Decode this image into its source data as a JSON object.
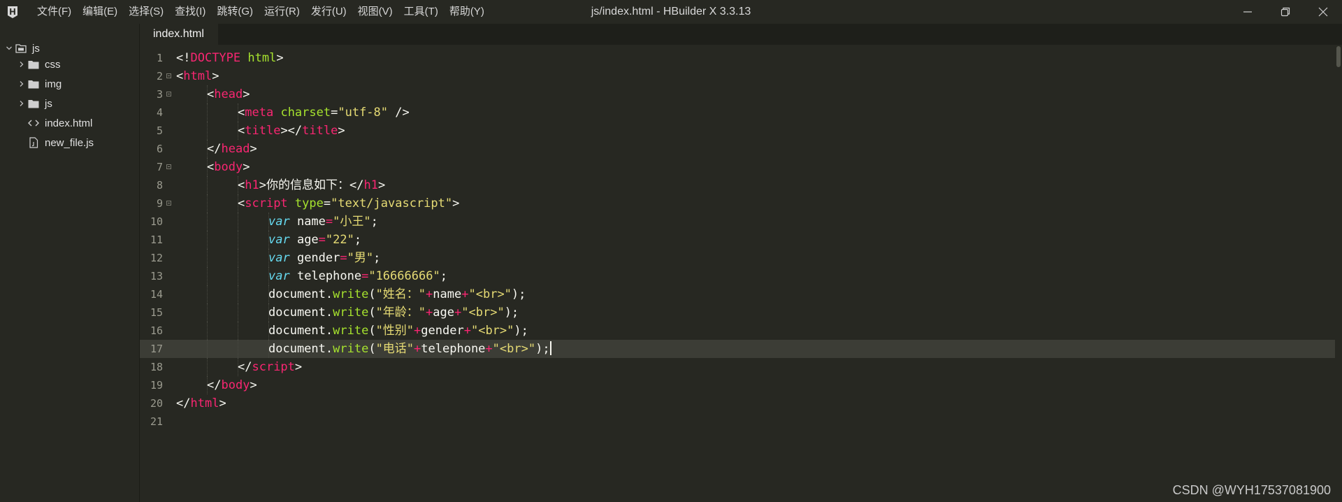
{
  "window": {
    "title": "js/index.html - HBuilder X 3.3.13",
    "app_icon": "hbuilder-logo",
    "controls": [
      "minimize-icon",
      "restore-icon",
      "close-icon"
    ]
  },
  "menu": [
    "文件(F)",
    "编辑(E)",
    "选择(S)",
    "查找(I)",
    "跳转(G)",
    "运行(R)",
    "发行(U)",
    "视图(V)",
    "工具(T)",
    "帮助(Y)"
  ],
  "sidebar": {
    "items": [
      {
        "label": "js",
        "icon": "project-icon",
        "chevron": "expanded",
        "level": 0
      },
      {
        "label": "css",
        "icon": "folder-icon",
        "chevron": "collapsed",
        "level": 1
      },
      {
        "label": "img",
        "icon": "folder-icon",
        "chevron": "collapsed",
        "level": 1
      },
      {
        "label": "js",
        "icon": "folder-icon",
        "chevron": "collapsed",
        "level": 1
      },
      {
        "label": "index.html",
        "icon": "html-file-icon",
        "chevron": "",
        "level": 1
      },
      {
        "label": "new_file.js",
        "icon": "js-file-icon",
        "chevron": "",
        "level": 1
      }
    ]
  },
  "tabs": [
    {
      "label": "index.html",
      "active": true
    }
  ],
  "editor": {
    "active_line": 17,
    "lines": [
      {
        "n": "1",
        "fold": false,
        "indent": 0,
        "tokens": [
          [
            "p",
            "<!"
          ],
          [
            "tag",
            "DOCTYPE"
          ],
          [
            "p",
            " "
          ],
          [
            "attr",
            "html"
          ],
          [
            "p",
            ">"
          ]
        ]
      },
      {
        "n": "2",
        "fold": true,
        "indent": 0,
        "tokens": [
          [
            "p",
            "<"
          ],
          [
            "tag",
            "html"
          ],
          [
            "p",
            ">"
          ]
        ]
      },
      {
        "n": "3",
        "fold": true,
        "indent": 1,
        "tokens": [
          [
            "p",
            "<"
          ],
          [
            "tag",
            "head"
          ],
          [
            "p",
            ">"
          ]
        ]
      },
      {
        "n": "4",
        "fold": false,
        "indent": 2,
        "tokens": [
          [
            "p",
            "<"
          ],
          [
            "tag",
            "meta"
          ],
          [
            "p",
            " "
          ],
          [
            "attr",
            "charset"
          ],
          [
            "p",
            "="
          ],
          [
            "str",
            "\"utf-8\""
          ],
          [
            "p",
            " />"
          ]
        ]
      },
      {
        "n": "5",
        "fold": false,
        "indent": 2,
        "tokens": [
          [
            "p",
            "<"
          ],
          [
            "tag",
            "title"
          ],
          [
            "p",
            "></"
          ],
          [
            "tag",
            "title"
          ],
          [
            "p",
            ">"
          ]
        ]
      },
      {
        "n": "6",
        "fold": false,
        "indent": 1,
        "tokens": [
          [
            "p",
            "</"
          ],
          [
            "tag",
            "head"
          ],
          [
            "p",
            ">"
          ]
        ]
      },
      {
        "n": "7",
        "fold": true,
        "indent": 1,
        "tokens": [
          [
            "p",
            "<"
          ],
          [
            "tag",
            "body"
          ],
          [
            "p",
            ">"
          ]
        ]
      },
      {
        "n": "8",
        "fold": false,
        "indent": 2,
        "tokens": [
          [
            "p",
            "<"
          ],
          [
            "tag",
            "h1"
          ],
          [
            "p",
            ">你的信息如下：</"
          ],
          [
            "tag",
            "h1"
          ],
          [
            "p",
            ">"
          ]
        ]
      },
      {
        "n": "9",
        "fold": true,
        "indent": 2,
        "tokens": [
          [
            "p",
            "<"
          ],
          [
            "tag",
            "script"
          ],
          [
            "p",
            " "
          ],
          [
            "attr",
            "type"
          ],
          [
            "p",
            "="
          ],
          [
            "str",
            "\"text/javascript\""
          ],
          [
            "p",
            ">"
          ]
        ]
      },
      {
        "n": "10",
        "fold": false,
        "indent": 3,
        "tokens": [
          [
            "kw",
            "var"
          ],
          [
            "p",
            " name"
          ],
          [
            "op",
            "="
          ],
          [
            "str",
            "\"小王\""
          ],
          [
            "p",
            ";"
          ]
        ]
      },
      {
        "n": "11",
        "fold": false,
        "indent": 3,
        "tokens": [
          [
            "kw",
            "var"
          ],
          [
            "p",
            " age"
          ],
          [
            "op",
            "="
          ],
          [
            "str",
            "\"22\""
          ],
          [
            "p",
            ";"
          ]
        ]
      },
      {
        "n": "12",
        "fold": false,
        "indent": 3,
        "tokens": [
          [
            "kw",
            "var"
          ],
          [
            "p",
            " gender"
          ],
          [
            "op",
            "="
          ],
          [
            "str",
            "\"男\""
          ],
          [
            "p",
            ";"
          ]
        ]
      },
      {
        "n": "13",
        "fold": false,
        "indent": 3,
        "tokens": [
          [
            "kw",
            "var"
          ],
          [
            "p",
            " telephone"
          ],
          [
            "op",
            "="
          ],
          [
            "str",
            "\"16666666\""
          ],
          [
            "p",
            ";"
          ]
        ]
      },
      {
        "n": "14",
        "fold": false,
        "indent": 3,
        "tokens": [
          [
            "p",
            "document."
          ],
          [
            "fn",
            "write"
          ],
          [
            "p",
            "("
          ],
          [
            "str",
            "\"姓名：\""
          ],
          [
            "op",
            "+"
          ],
          [
            "p",
            "name"
          ],
          [
            "op",
            "+"
          ],
          [
            "str",
            "\"<br>\""
          ],
          [
            "p",
            ");"
          ]
        ]
      },
      {
        "n": "15",
        "fold": false,
        "indent": 3,
        "tokens": [
          [
            "p",
            "document."
          ],
          [
            "fn",
            "write"
          ],
          [
            "p",
            "("
          ],
          [
            "str",
            "\"年龄：\""
          ],
          [
            "op",
            "+"
          ],
          [
            "p",
            "age"
          ],
          [
            "op",
            "+"
          ],
          [
            "str",
            "\"<br>\""
          ],
          [
            "p",
            ");"
          ]
        ]
      },
      {
        "n": "16",
        "fold": false,
        "indent": 3,
        "tokens": [
          [
            "p",
            "document."
          ],
          [
            "fn",
            "write"
          ],
          [
            "p",
            "("
          ],
          [
            "str",
            "\"性别\""
          ],
          [
            "op",
            "+"
          ],
          [
            "p",
            "gender"
          ],
          [
            "op",
            "+"
          ],
          [
            "str",
            "\"<br>\""
          ],
          [
            "p",
            ");"
          ]
        ]
      },
      {
        "n": "17",
        "fold": false,
        "indent": 3,
        "tokens": [
          [
            "p",
            "document."
          ],
          [
            "fn",
            "write"
          ],
          [
            "p",
            "("
          ],
          [
            "str",
            "\"电话\""
          ],
          [
            "op",
            "+"
          ],
          [
            "p",
            "telephone"
          ],
          [
            "op",
            "+"
          ],
          [
            "str",
            "\"<br>\""
          ],
          [
            "p",
            ");"
          ]
        ]
      },
      {
        "n": "18",
        "fold": false,
        "indent": 2,
        "tokens": [
          [
            "p",
            "</"
          ],
          [
            "tag",
            "script"
          ],
          [
            "p",
            ">"
          ]
        ]
      },
      {
        "n": "19",
        "fold": false,
        "indent": 1,
        "tokens": [
          [
            "p",
            "</"
          ],
          [
            "tag",
            "body"
          ],
          [
            "p",
            ">"
          ]
        ]
      },
      {
        "n": "20",
        "fold": false,
        "indent": 0,
        "tokens": [
          [
            "p",
            "</"
          ],
          [
            "tag",
            "html"
          ],
          [
            "p",
            ">"
          ]
        ]
      },
      {
        "n": "21",
        "fold": false,
        "indent": 0,
        "tokens": []
      }
    ]
  },
  "watermark": "CSDN @WYH17537081900",
  "colors": {
    "background": "#272822",
    "tag": "#f92672",
    "attribute": "#a6e22e",
    "string": "#e6db74",
    "keyword": "#66d9ef",
    "text": "#f8f8f2"
  }
}
